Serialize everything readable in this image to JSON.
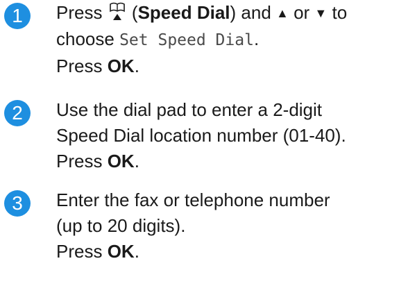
{
  "steps": [
    {
      "number": "1",
      "line1": {
        "prefix": "Press ",
        "speed_dial_open": " (",
        "speed_dial_label": "Speed Dial",
        "speed_dial_close": ") and ",
        "up_arrow": "▲",
        "or_text": " or ",
        "down_arrow": "▼",
        "suffix": " to"
      },
      "line2": {
        "prefix": "choose ",
        "menu_item": "Set Speed Dial",
        "suffix": "."
      },
      "line3": {
        "prefix": "Press ",
        "key": "OK",
        "suffix": "."
      }
    },
    {
      "number": "2",
      "line1": "Use the dial pad to enter a 2-digit",
      "line2": "Speed Dial location number (01-40).",
      "line3": {
        "prefix": "Press ",
        "key": "OK",
        "suffix": "."
      }
    },
    {
      "number": "3",
      "line1": "Enter the fax or telephone number",
      "line2": "(up to 20 digits).",
      "line3": {
        "prefix": "Press ",
        "key": "OK",
        "suffix": "."
      }
    }
  ],
  "colors": {
    "badge": "#1e8fe0",
    "text": "#1a1a1a",
    "menu_text": "#4a4a4a"
  },
  "icons": {
    "speed_dial": "book-with-up-arrow-icon"
  }
}
